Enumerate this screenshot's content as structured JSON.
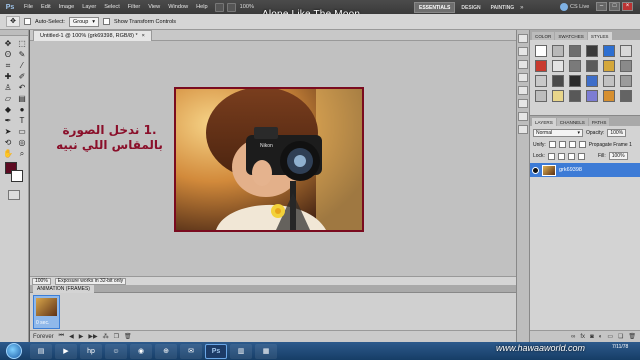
{
  "app": {
    "logo": "Ps",
    "zoom": "100%",
    "overlay_title": "Alone Like The Moon"
  },
  "menu": [
    "File",
    "Edit",
    "Image",
    "Layer",
    "Select",
    "Filter",
    "View",
    "Window",
    "Help"
  ],
  "workspaces": {
    "active": "ESSENTIALS",
    "items": [
      "ESSENTIALS",
      "DESIGN",
      "PAINTING"
    ],
    "more": "»"
  },
  "cs_live": "CS Live",
  "window_buttons": {
    "minimize": "–",
    "restore": "□",
    "close": "×"
  },
  "options": {
    "tool_icon": "move-icon",
    "auto_select_label": "Auto-Select:",
    "auto_select_value": "Group",
    "show_transform_label": "Show Transform Controls"
  },
  "document": {
    "tab_label": "Untitled-1 @ 100% (grk69398, RGB/8) *",
    "tab_close": "×",
    "note_line1": ".1 ندخل الصورة",
    "note_line2": "بالمقاس اللي نبيه",
    "photo_brand": "Nikon"
  },
  "status": {
    "zoom": "100%",
    "message": "Exposure works in 32-bit only"
  },
  "animation": {
    "tab_label": "ANIMATION (FRAMES)",
    "frame_duration": "0 sec.",
    "loop": "Forever"
  },
  "panels": {
    "top_tabs": [
      "COLOR",
      "SWATCHES",
      "STYLES"
    ],
    "active_top_tab": "STYLES",
    "style_swatches": [
      "#ffffff",
      "#b8b8b8",
      "#6e6e6e",
      "#3a3a3a",
      "#2d6fd1",
      "#d8d8d8",
      "#c83a2e",
      "#e3e3e3",
      "#7a7a7a",
      "#5a5a5a",
      "#d4a73a",
      "#8a8a8a",
      "#c9c9c9",
      "#4a4a4a",
      "#2b2b2b",
      "#3e6ec9",
      "#c1c1c1",
      "#9b9b9b",
      "#bdbdbd",
      "#e8d58a",
      "#585858",
      "#7c7cd4",
      "#d68f2f",
      "#646464"
    ],
    "layer_tabs": [
      "LAYERS",
      "CHANNELS",
      "PATHS"
    ],
    "active_layer_tab": "LAYERS",
    "blend_mode": "Normal",
    "opacity_label": "Opacity:",
    "opacity_value": "100%",
    "unify_label": "Unify:",
    "propagate_label": "Propagate Frame 1",
    "lock_label": "Lock:",
    "fill_label": "Fill:",
    "fill_value": "100%",
    "layer_name": "grk69398"
  },
  "taskbar": {
    "watermark": "www.hawaaworld.com",
    "clock_time": "",
    "clock_date": "7/11/78",
    "apps": [
      "folder-icon",
      "media-icon",
      "hp-icon",
      "messenger-icon",
      "player-icon",
      "network-icon",
      "photoshop-icon",
      "chat-icon",
      "folder-icon",
      "ps-docs-icon"
    ]
  }
}
